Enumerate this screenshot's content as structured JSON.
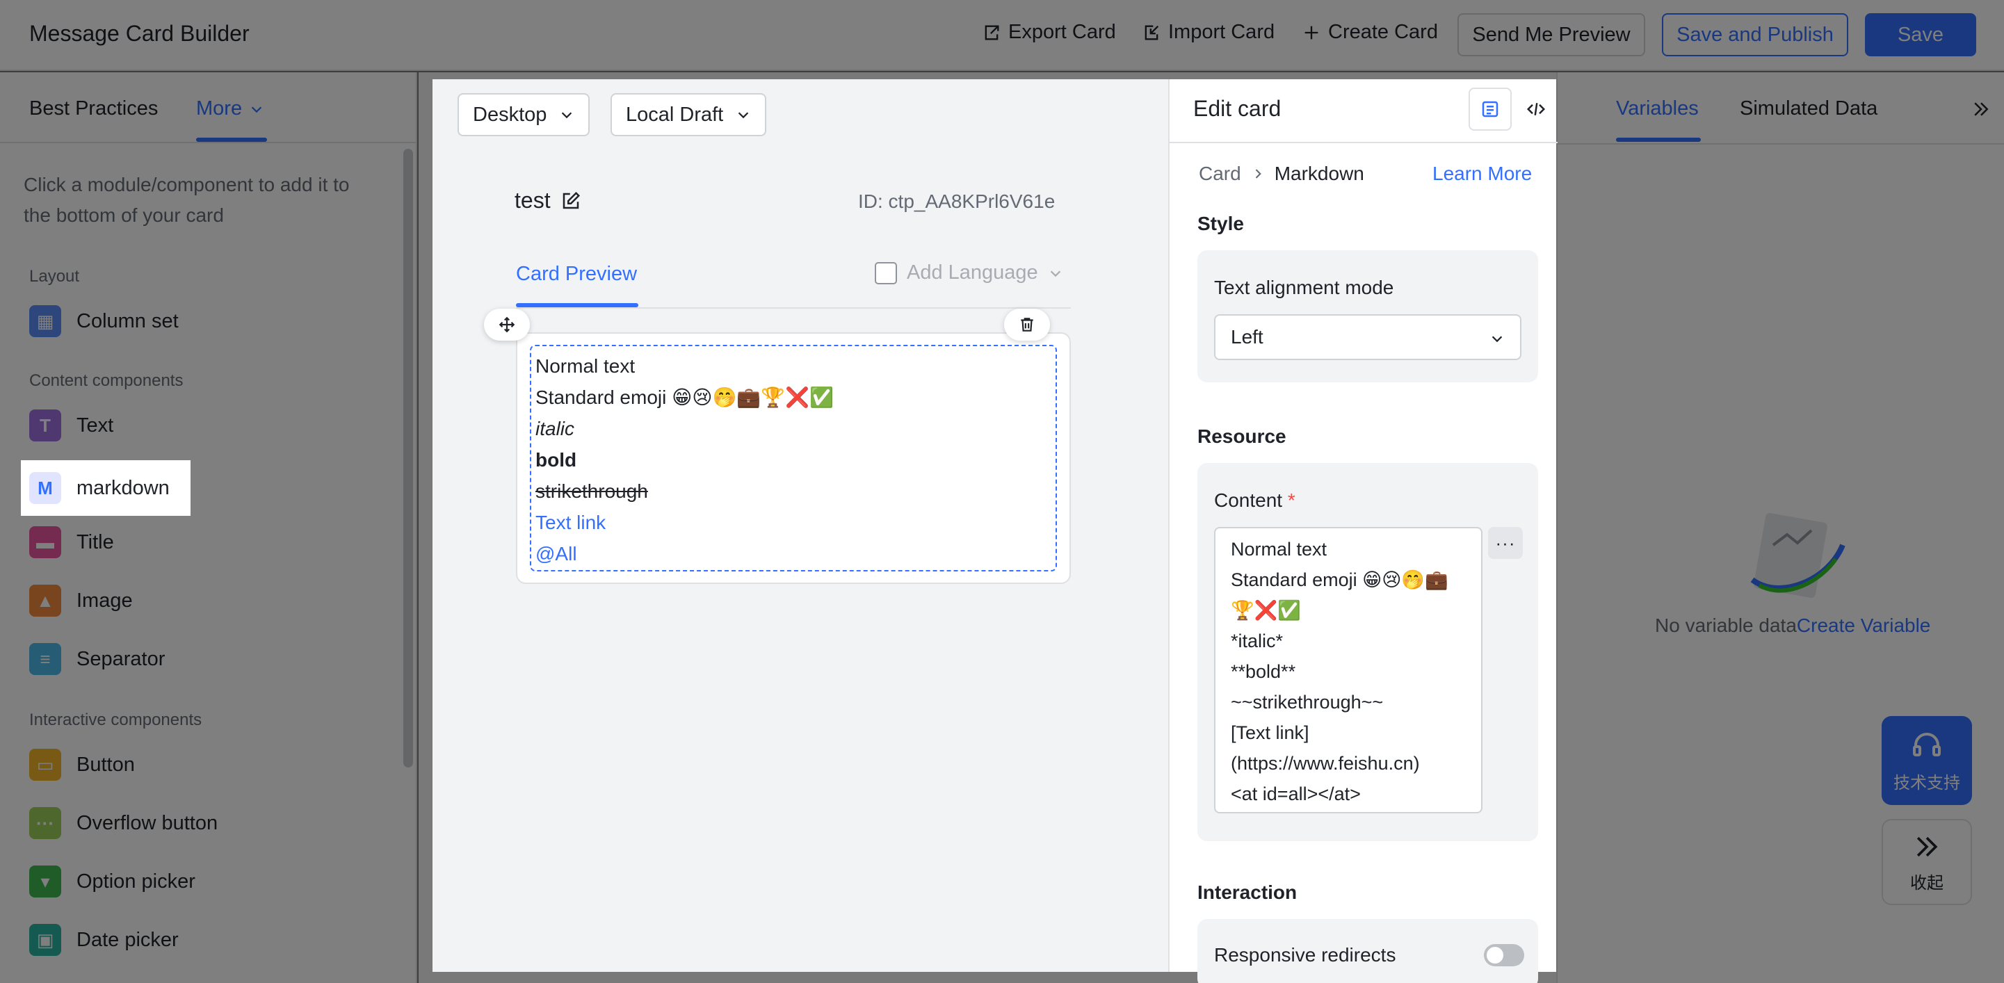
{
  "app": {
    "title": "Message Card Builder"
  },
  "toolbar": {
    "export_label": "Export Card",
    "import_label": "Import Card",
    "create_label": "Create Card",
    "send_preview_label": "Send Me Preview",
    "save_publish_label": "Save and Publish",
    "save_label": "Save"
  },
  "left": {
    "tabs": [
      "Best Practices",
      "More"
    ],
    "hint": "Click a module/component to add it to the bottom of your card",
    "groups": {
      "layout": "Layout",
      "content": "Content components",
      "interactive": "Interactive components"
    },
    "items": {
      "column_set": "Column set",
      "text": "Text",
      "markdown": "markdown",
      "title": "Title",
      "image": "Image",
      "separator": "Separator",
      "button": "Button",
      "overflow": "Overflow button",
      "option_picker": "Option picker",
      "date_picker": "Date picker"
    }
  },
  "canvas": {
    "device": "Desktop",
    "version": "Local Draft",
    "card_name": "test",
    "card_id": "ID: ctp_AA8KPrl6V61e",
    "preview_tab": "Card Preview",
    "add_language": "Add Language",
    "markdown_lines": {
      "normal": "Normal text",
      "emoji": "Standard emoji 😁😢🤭💼🏆❌✅",
      "italic": "italic",
      "bold": "bold",
      "strike": "strikethrough",
      "link": "Text link",
      "at": "@All"
    }
  },
  "edit": {
    "title": "Edit card",
    "crumb_root": "Card",
    "crumb_current": "Markdown",
    "learn_more": "Learn More",
    "style_title": "Style",
    "align_label": "Text alignment mode",
    "align_value": "Left",
    "resource_title": "Resource",
    "content_label": "Content",
    "required_mark": "*",
    "content_lines": [
      "Normal text",
      "Standard emoji 😁😢🤭💼",
      "🏆❌✅",
      "*italic*",
      "**bold**",
      "~~strikethrough~~",
      "[Text link]",
      "(https://www.feishu.cn)",
      "<at id=all></at>"
    ],
    "more_label": "···",
    "interaction_title": "Interaction",
    "redirect_label": "Responsive redirects"
  },
  "right": {
    "tabs": [
      "Variables",
      "Simulated Data"
    ],
    "empty_text": "No variable data",
    "create_link": "Create Variable"
  },
  "float": {
    "support_label": "技术支持",
    "collapse_label": "收起"
  },
  "colors": {
    "accent": "#3370ff",
    "danger": "#f54a45"
  }
}
